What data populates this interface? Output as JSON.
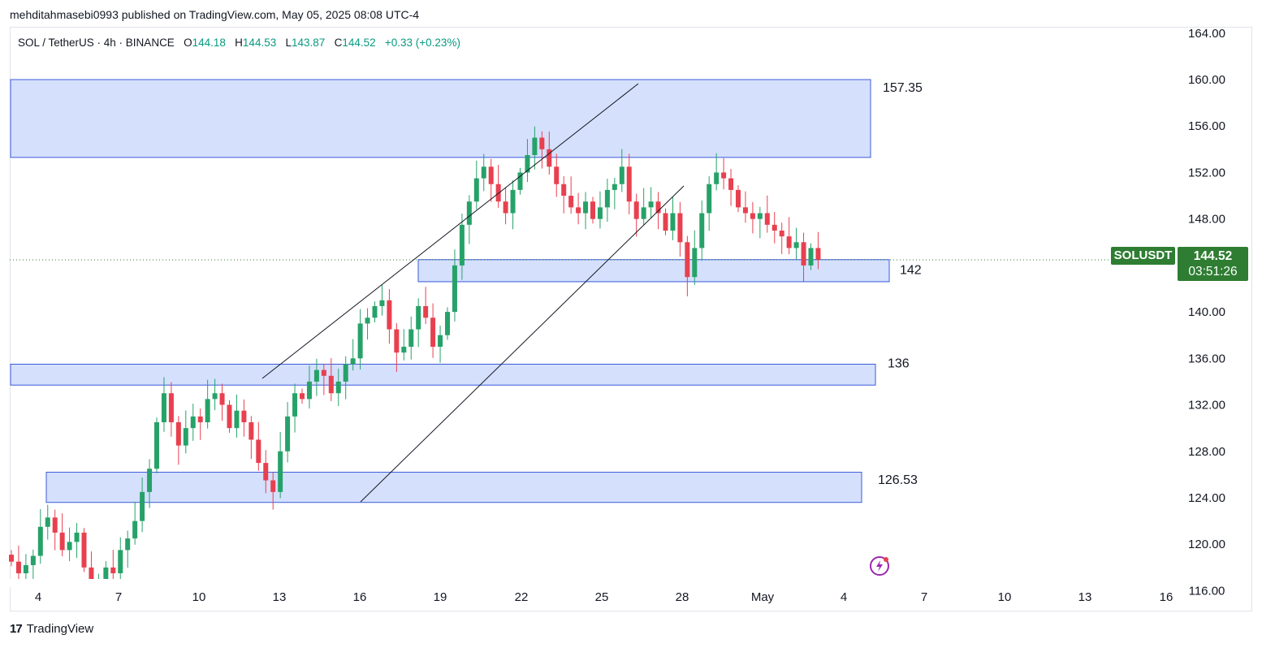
{
  "header": {
    "published_line": "mehditahmasebi0993 published on TradingView.com, May 05, 2025 08:08 UTC-4"
  },
  "legend": {
    "symbol": "SOL / TetherUS · 4h · BINANCE",
    "open_label": "O",
    "open": "144.18",
    "high_label": "H",
    "high": "144.53",
    "low_label": "L",
    "low": "143.87",
    "close_label": "C",
    "close": "144.52",
    "change": "+0.33 (+0.23%)"
  },
  "price_tag": {
    "symbol": "SOLUSDT",
    "price": "144.52",
    "countdown": "03:51:26",
    "color": "#2e7d32"
  },
  "footer": {
    "brand": "TradingView"
  },
  "chart_data": {
    "type": "candlestick",
    "symbol": "SOLUSDT",
    "timeframe": "4h",
    "exchange": "BINANCE",
    "colors": {
      "up": "#26a269",
      "down": "#e8404f",
      "zone_fill": "#d5e0fd",
      "zone_border": "#3a5bd9"
    },
    "y_axis": {
      "ticks": [
        "164.00",
        "160.00",
        "156.00",
        "152.00",
        "148.00",
        "144.00",
        "140.00",
        "136.00",
        "132.00",
        "128.00",
        "124.00",
        "120.00",
        "116.00"
      ],
      "range": [
        116,
        165
      ]
    },
    "x_axis": {
      "ticks": [
        "4",
        "7",
        "10",
        "13",
        "16",
        "19",
        "22",
        "25",
        "28",
        "May",
        "4",
        "7",
        "10",
        "13",
        "16"
      ]
    },
    "zones": [
      {
        "label": "157.35",
        "top": 160.0,
        "bottom": 153.3
      },
      {
        "label": "142",
        "top": 144.5,
        "bottom": 142.6
      },
      {
        "label": "136",
        "top": 135.5,
        "bottom": 133.7
      },
      {
        "label": "126.53",
        "top": 126.2,
        "bottom": 123.6
      }
    ],
    "channel": {
      "upper": [
        [
          133.7,
          159.6
        ]
      ],
      "lower": [
        [
          122.7,
          151.0
        ]
      ]
    },
    "current_price": 144.52,
    "candles_close_path": [
      118.5,
      117.5,
      118.2,
      119.0,
      121.5,
      122.3,
      121.0,
      119.5,
      120.2,
      121.0,
      118.0,
      116.0,
      116.5,
      118.0,
      117.5,
      119.5,
      120.5,
      122.0,
      124.5,
      126.5,
      130.5,
      133.0,
      130.5,
      128.5,
      130.0,
      131.0,
      130.5,
      132.5,
      133.0,
      132.0,
      130.0,
      131.5,
      130.5,
      129.0,
      127.0,
      125.5,
      124.5,
      128.0,
      131.0,
      133.0,
      132.5,
      134.0,
      135.0,
      134.5,
      133.0,
      134.0,
      135.5,
      136.0,
      139.0,
      139.5,
      140.5,
      141.0,
      138.5,
      136.5,
      137.0,
      138.5,
      140.5,
      139.5,
      137.0,
      138.0,
      140.0,
      144.0,
      147.5,
      149.5,
      151.5,
      152.5,
      151.0,
      149.5,
      148.5,
      150.5,
      152.0,
      153.5,
      155.0,
      154.0,
      152.5,
      151.0,
      150.0,
      149.0,
      148.5,
      149.5,
      148.0,
      149.0,
      150.5,
      151.0,
      152.5,
      149.5,
      148.0,
      149.0,
      149.5,
      148.5,
      147.0,
      148.5,
      146.0,
      143.0,
      145.5,
      148.5,
      151.0,
      152.0,
      151.5,
      150.5,
      149.0,
      148.5,
      148.0,
      148.5,
      147.5,
      147.0,
      146.5,
      145.5,
      146.0,
      144.0,
      145.5,
      144.5
    ]
  }
}
